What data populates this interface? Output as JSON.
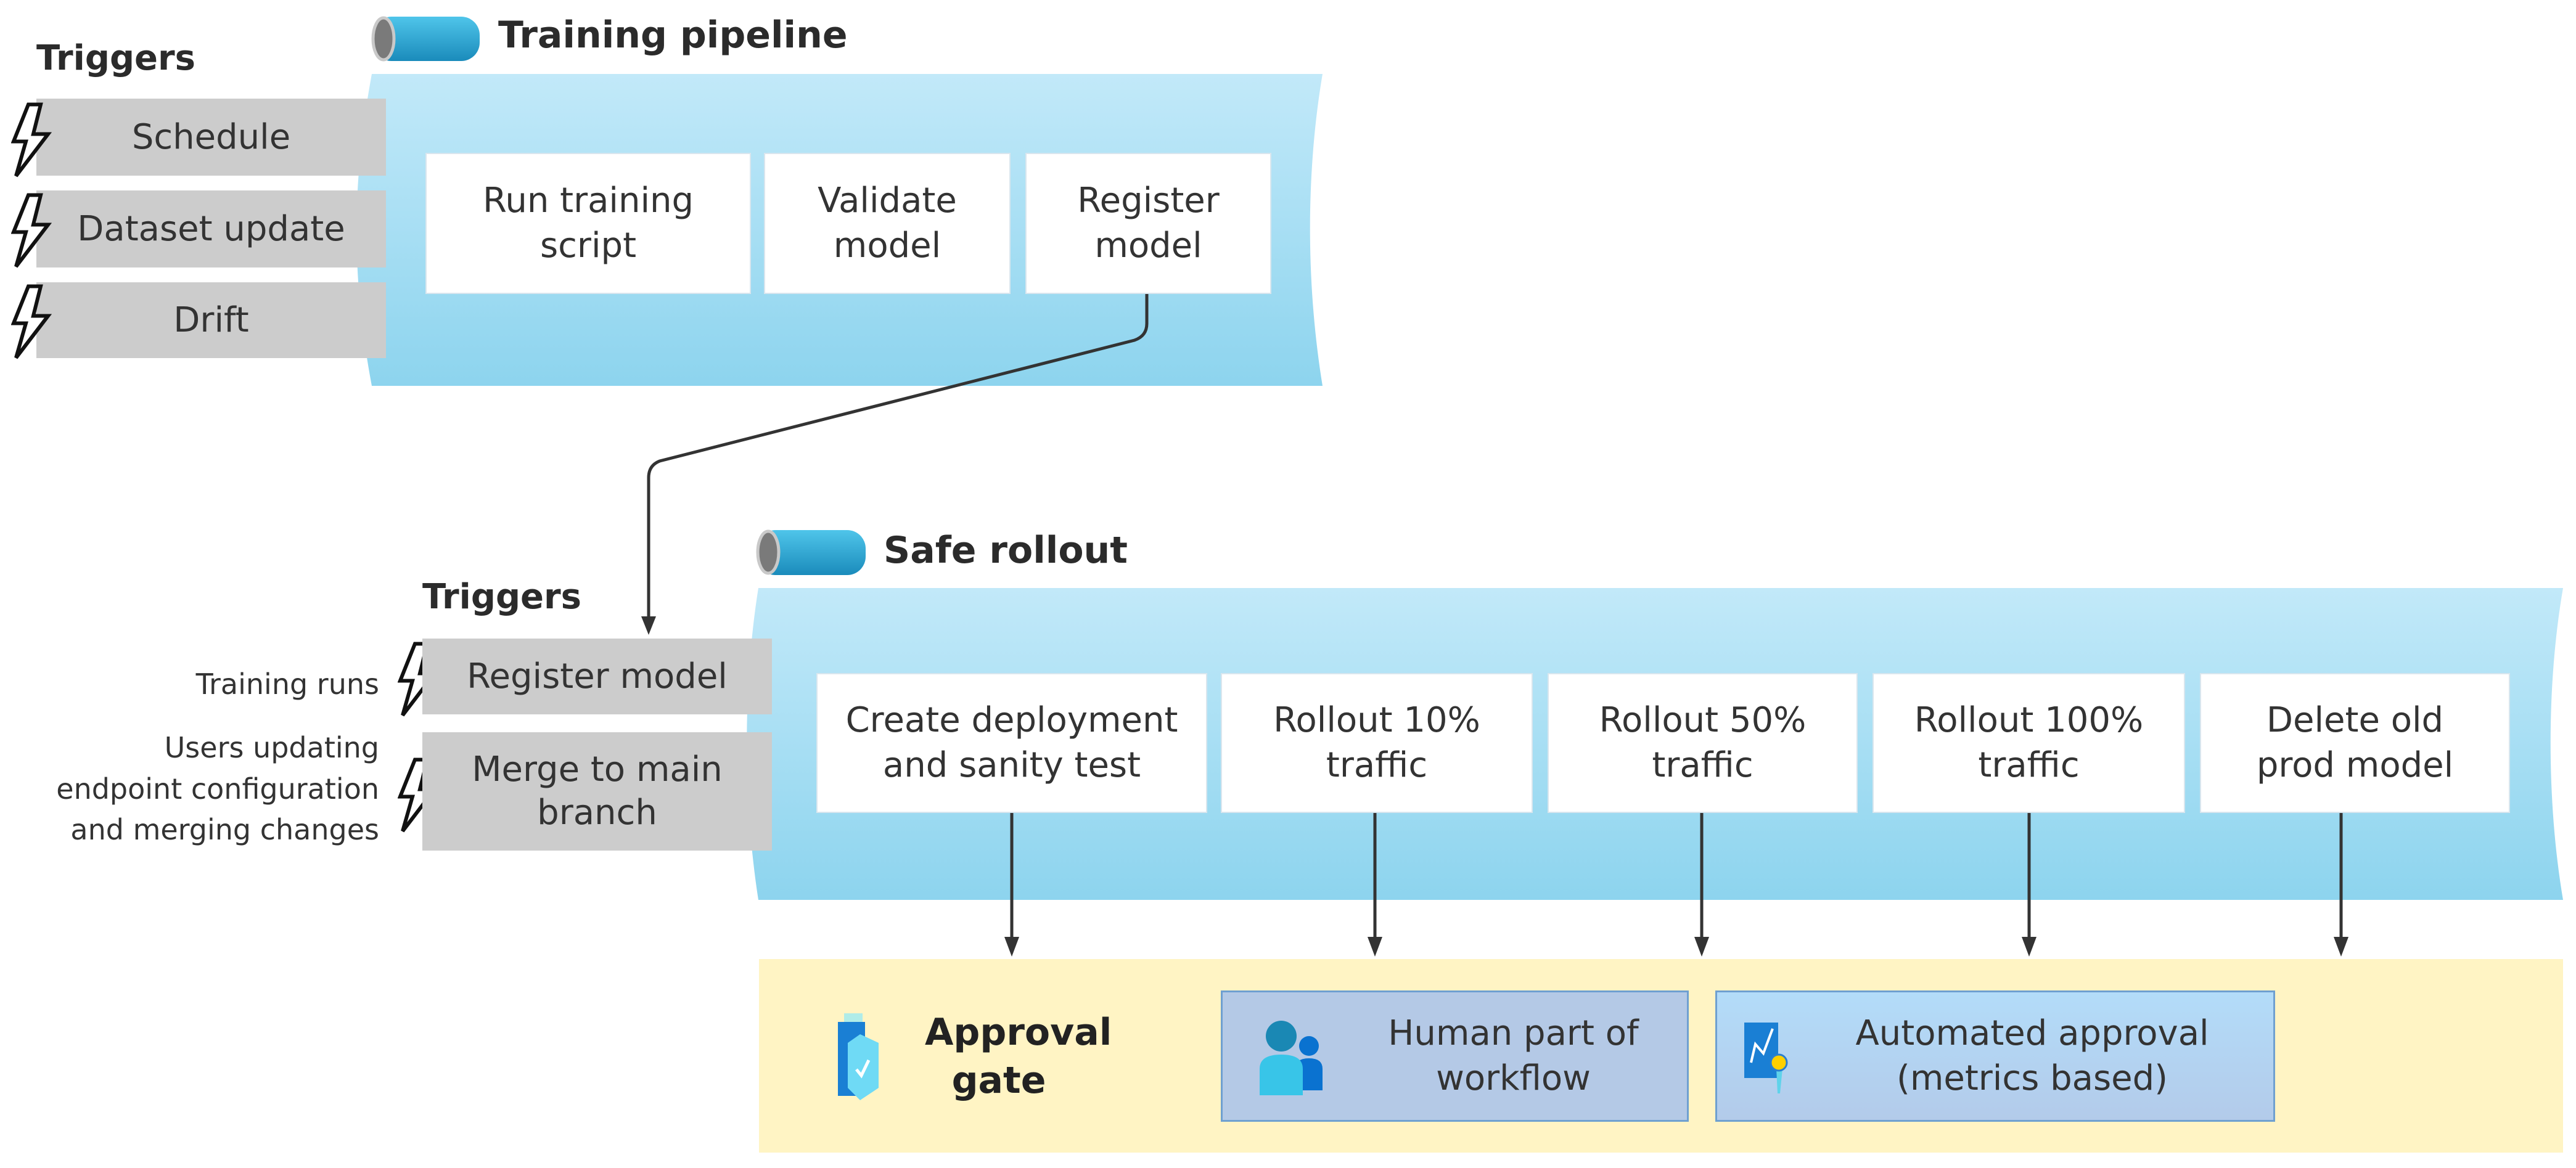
{
  "training": {
    "title": "Training pipeline",
    "triggers_heading": "Triggers",
    "triggers": [
      "Schedule",
      "Dataset update",
      "Drift"
    ],
    "steps": [
      "Run training\nscript",
      "Validate\nmodel",
      "Register\nmodel"
    ]
  },
  "rollout": {
    "title": "Safe rollout",
    "triggers_heading": "Triggers",
    "triggers": [
      "Register model",
      "Merge to main\nbranch"
    ],
    "trigger_notes": [
      "Training runs",
      "Users updating\nendpoint configuration\nand merging changes"
    ],
    "steps": [
      "Create deployment\nand sanity test",
      "Rollout 10%\ntraffic",
      "Rollout 50%\ntraffic",
      "Rollout 100%\ntraffic",
      "Delete old\nprod model"
    ]
  },
  "approval": {
    "title": "Approval\ngate",
    "human": "Human part of\nworkflow",
    "automated": "Automated approval\n(metrics based)"
  },
  "colors": {
    "pipeline_top": "#c2e9f9",
    "pipeline_bottom": "#8dd4ee",
    "trigger_box": "#cccccc",
    "approval_bg": "#fff4c4",
    "human_box": "#b4c9e6",
    "automated_box": "#b3dcf9",
    "connector": "#333333"
  },
  "icons": [
    "pipeline-icon",
    "lightning-icon",
    "approval-shield-icon",
    "users-icon",
    "metrics-badge-icon"
  ]
}
